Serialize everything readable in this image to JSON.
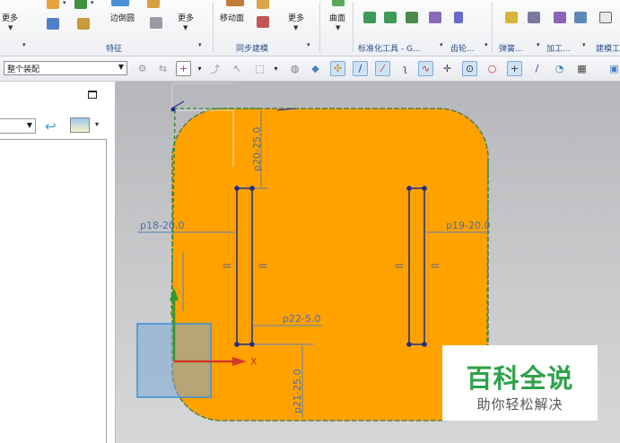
{
  "ribbon": {
    "more_label": "更多",
    "edge_blend_label": "边倒圆",
    "more_label2": "更多",
    "feature_group": "特征",
    "move_face_label": "移动面",
    "more_label3": "更多",
    "sync_group": "同步建模",
    "surface_label": "曲面",
    "std_tools_group": "标准化工具 - G...",
    "gear_group": "齿轮...",
    "spring_group": "弹簧...",
    "machining_group": "加工...",
    "modeling_group": "建模工"
  },
  "toolbar": {
    "filter_value": "整个装配"
  },
  "left_panel": {
    "maximize_label": "□"
  },
  "sketch": {
    "dim_top": "p20-25.0",
    "dim_left": "p18-20.0",
    "dim_right": "p19-20.0",
    "dim_middle": "p22-5.0",
    "dim_bottom": "p21-25.0",
    "eq1": "=",
    "eq2": "=",
    "eq3": "=",
    "eq4": "=",
    "axis_x": "X"
  },
  "watermark": {
    "title": "百科全说",
    "subtitle": "助你轻松解决"
  },
  "colors": {
    "body_fill": "#ffa200",
    "sketch_line": "#1c2d8c",
    "dim_line": "#5a7fbf",
    "watermark_title": "#2fa24a"
  }
}
